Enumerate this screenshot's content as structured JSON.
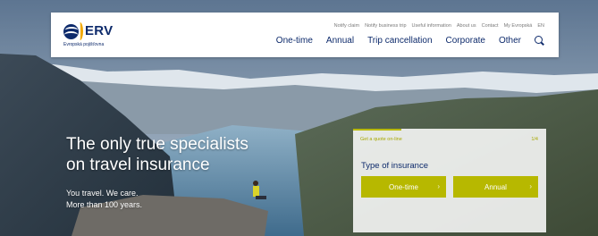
{
  "logo": {
    "name": "ERV",
    "subtitle": "Evropská pojišťovna"
  },
  "top_links": [
    "Notify claim",
    "Notify business trip",
    "Useful information",
    "About us",
    "Contact",
    "My Evropská",
    "EN"
  ],
  "main_nav": [
    "One-time",
    "Annual",
    "Trip cancellation",
    "Corporate",
    "Other"
  ],
  "hero": {
    "headline_line1": "The only true specialists",
    "headline_line2": "on travel insurance",
    "tagline_line1": "You travel. We care.",
    "tagline_line2": "More than 100 years."
  },
  "quote": {
    "link": "Get a quote on-line",
    "step": "1/4",
    "progress": 0.25,
    "title": "Type of insurance",
    "options": [
      "One-time",
      "Annual"
    ]
  },
  "colors": {
    "brand_navy": "#0d2a6b",
    "accent_olive": "#b7b800",
    "logo_orange": "#f2a900"
  }
}
